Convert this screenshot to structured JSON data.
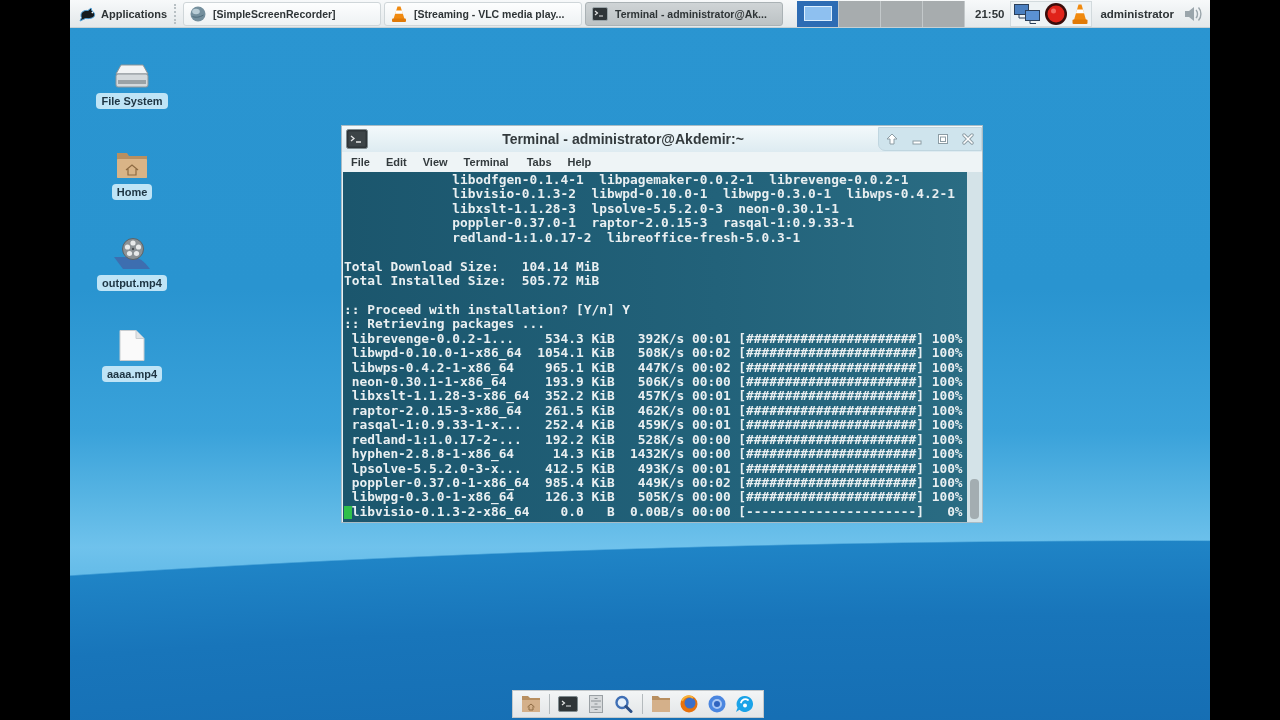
{
  "top_panel": {
    "applications_menu": {
      "label": "Applications"
    },
    "tasks": [
      {
        "label": "[SimpleScreenRecorder]",
        "kind": "globe",
        "selected": false
      },
      {
        "label": "[Streaming - VLC media play...",
        "kind": "cone",
        "selected": false
      },
      {
        "label": "Terminal - administrator@Ak...",
        "kind": "terminal",
        "selected": true
      }
    ],
    "workspaces": [
      {
        "selected": true,
        "has_window": true
      },
      {
        "selected": false,
        "has_window": false
      },
      {
        "selected": false,
        "has_window": false
      },
      {
        "selected": false,
        "has_window": false
      }
    ],
    "clock": "21:50",
    "tray": [
      {
        "kind": "network"
      },
      {
        "kind": "record"
      },
      {
        "kind": "cone"
      }
    ],
    "user": "administrator"
  },
  "desktop_icons": [
    {
      "label": "File System",
      "kind": "drive"
    },
    {
      "label": "Home",
      "kind": "home"
    },
    {
      "label": "output.mp4",
      "kind": "video"
    },
    {
      "label": "aaaa.mp4",
      "kind": "file"
    }
  ],
  "terminal": {
    "title": "Terminal - administrator@Akdemir:~",
    "menu": [
      "File",
      "Edit",
      "View",
      "Terminal",
      "Tabs",
      "Help"
    ],
    "package_list": [
      "libodfgen-0.1.4-1  libpagemaker-0.0.2-1  librevenge-0.0.2-1",
      "libvisio-0.1.3-2  libwpd-0.10.0-1  libwpg-0.3.0-1  libwps-0.4.2-1",
      "libxslt-1.1.28-3  lpsolve-5.5.2.0-3  neon-0.30.1-1",
      "poppler-0.37.0-1  raptor-2.0.15-3  rasqal-1:0.9.33-1",
      "redland-1:1.0.17-2  libreoffice-fresh-5.0.3-1"
    ],
    "totals": [
      "Total Download Size:   104.14 MiB",
      "Total Installed Size:  505.72 MiB"
    ],
    "prompts": [
      ":: Proceed with installation? [Y/n] Y",
      ":: Retrieving packages ..."
    ],
    "downloads": [
      {
        "text": "librevenge-0.0.2-1...    534.3 KiB   392K/s 00:01 [######################] 100%",
        "cursor": false
      },
      {
        "text": "libwpd-0.10.0-1-x86_64  1054.1 KiB   508K/s 00:02 [######################] 100%",
        "cursor": false
      },
      {
        "text": "libwps-0.4.2-1-x86_64    965.1 KiB   447K/s 00:02 [######################] 100%",
        "cursor": false
      },
      {
        "text": "neon-0.30.1-1-x86_64     193.9 KiB   506K/s 00:00 [######################] 100%",
        "cursor": false
      },
      {
        "text": "libxslt-1.1.28-3-x86_64  352.2 KiB   457K/s 00:01 [######################] 100%",
        "cursor": false
      },
      {
        "text": "raptor-2.0.15-3-x86_64   261.5 KiB   462K/s 00:01 [######################] 100%",
        "cursor": false
      },
      {
        "text": "rasqal-1:0.9.33-1-x...   252.4 KiB   459K/s 00:01 [######################] 100%",
        "cursor": false
      },
      {
        "text": "redland-1:1.0.17-2-...   192.2 KiB   528K/s 00:00 [######################] 100%",
        "cursor": false
      },
      {
        "text": "hyphen-2.8.8-1-x86_64     14.3 KiB  1432K/s 00:00 [######################] 100%",
        "cursor": false
      },
      {
        "text": "lpsolve-5.5.2.0-3-x...   412.5 KiB   493K/s 00:01 [######################] 100%",
        "cursor": false
      },
      {
        "text": "poppler-0.37.0-1-x86_64  985.4 KiB   449K/s 00:02 [######################] 100%",
        "cursor": false
      },
      {
        "text": "libwpg-0.3.0-1-x86_64    126.3 KiB   505K/s 00:00 [######################] 100%",
        "cursor": false
      },
      {
        "text": "libvisio-0.1.3-2-x86_64    0.0   B  0.00B/s 00:00 [----------------------]   0%",
        "cursor": true
      }
    ]
  },
  "dock": [
    {
      "kind": "home_folder"
    },
    {
      "kind": "separator"
    },
    {
      "kind": "terminal"
    },
    {
      "kind": "cabinet"
    },
    {
      "kind": "search"
    },
    {
      "kind": "separator"
    },
    {
      "kind": "folder"
    },
    {
      "kind": "fox_globe"
    },
    {
      "kind": "ring"
    },
    {
      "kind": "chat"
    }
  ]
}
